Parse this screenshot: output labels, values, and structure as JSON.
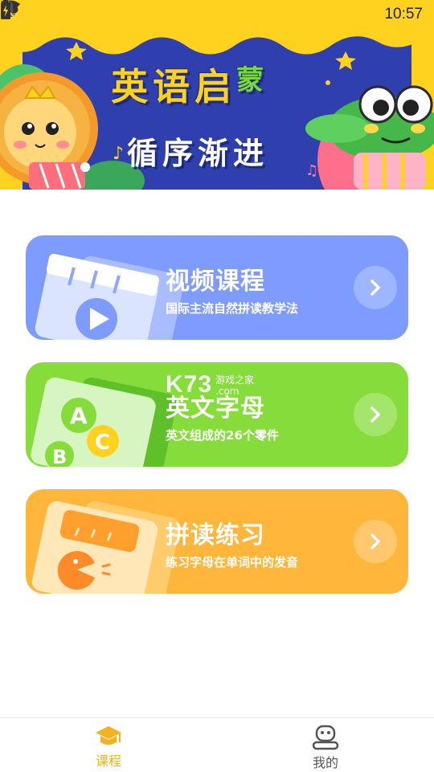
{
  "status_bar": {
    "time": "10:57",
    "icons": [
      "gallery-icon",
      "wechat-icon",
      "wifi-icon",
      "no-sim-icon",
      "battery-charging-icon"
    ]
  },
  "banner": {
    "title_main": "英语启",
    "title_accent": "蒙",
    "subtitle": "循序渐进",
    "colors": {
      "sky": "#2f3fae",
      "curtain": "#ffd21f",
      "title": "#ffd21f"
    }
  },
  "courses": [
    {
      "title": "视频课程",
      "description": "国际主流自然拼读教学法",
      "color": "#7e9cff",
      "icon": "video-book-icon"
    },
    {
      "title": "英文字母",
      "description": "英文组成的26个零件",
      "color": "#86dc3b",
      "icon": "alphabet-abc-icon"
    },
    {
      "title": "拼读练习",
      "description": "练习字母在单词中的发音",
      "color": "#ffb63b",
      "icon": "pacman-practice-icon"
    }
  ],
  "watermark": {
    "logo": "K73",
    "line1": "游戏之家",
    "line2": ".com"
  },
  "bottom_nav": [
    {
      "label": "课程",
      "icon": "graduation-cap-icon",
      "active": true,
      "color": "#f3b223"
    },
    {
      "label": "我的",
      "icon": "robot-profile-icon",
      "active": false,
      "color": "#555555"
    }
  ]
}
